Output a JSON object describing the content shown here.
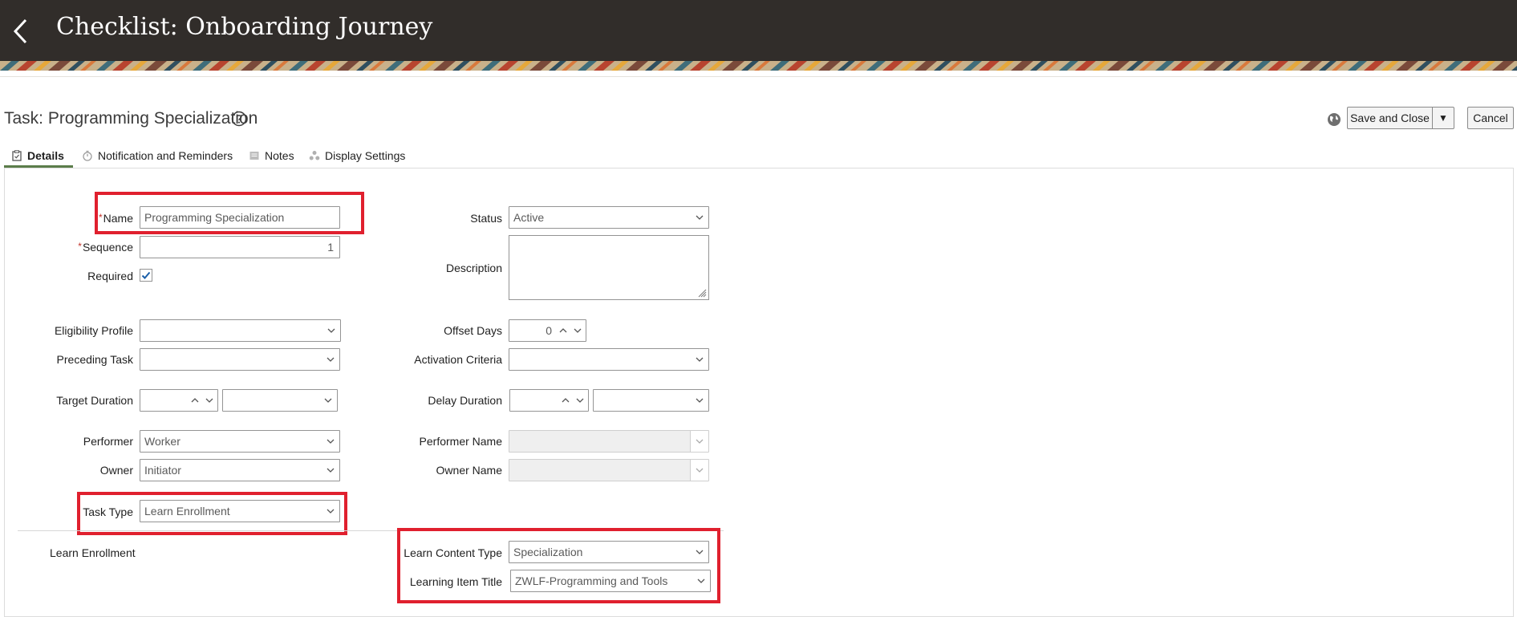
{
  "header": {
    "title": "Checklist: Onboarding Journey"
  },
  "task": {
    "title": "Task: Programming Specialization"
  },
  "actions": {
    "save_label": "Save and Close",
    "cancel_label": "Cancel"
  },
  "tabs": [
    {
      "label": "Details",
      "icon": "clipboard-icon"
    },
    {
      "label": "Notification and Reminders",
      "icon": "stopwatch-icon"
    },
    {
      "label": "Notes",
      "icon": "note-icon"
    },
    {
      "label": "Display Settings",
      "icon": "people-icon"
    }
  ],
  "form": {
    "name": {
      "label": "Name",
      "value": "Programming Specialization",
      "required": true
    },
    "sequence": {
      "label": "Sequence",
      "value": "1",
      "required": true
    },
    "required": {
      "label": "Required",
      "checked": true
    },
    "status": {
      "label": "Status",
      "value": "Active"
    },
    "description": {
      "label": "Description",
      "value": ""
    },
    "eligibility_profile": {
      "label": "Eligibility Profile",
      "value": ""
    },
    "offset_days": {
      "label": "Offset Days",
      "value": "0"
    },
    "preceding_task": {
      "label": "Preceding Task",
      "value": ""
    },
    "activation_criteria": {
      "label": "Activation Criteria",
      "value": ""
    },
    "target_duration": {
      "label": "Target Duration",
      "value": "",
      "unit": ""
    },
    "delay_duration": {
      "label": "Delay Duration",
      "value": "",
      "unit": ""
    },
    "performer": {
      "label": "Performer",
      "value": "Worker"
    },
    "performer_name": {
      "label": "Performer Name",
      "value": ""
    },
    "owner": {
      "label": "Owner",
      "value": "Initiator"
    },
    "owner_name": {
      "label": "Owner Name",
      "value": ""
    },
    "task_type": {
      "label": "Task Type",
      "value": "Learn Enrollment"
    }
  },
  "learn_section": {
    "title": "Learn Enrollment",
    "content_type": {
      "label": "Learn Content Type",
      "value": "Specialization"
    },
    "item_title": {
      "label": "Learning Item Title",
      "value": "ZWLF-Programming and Tools"
    }
  },
  "colors": {
    "header_bg": "#312d2a",
    "highlight": "#e0202e",
    "tab_active": "#5b7d4a",
    "required_star": "#c2332a"
  }
}
